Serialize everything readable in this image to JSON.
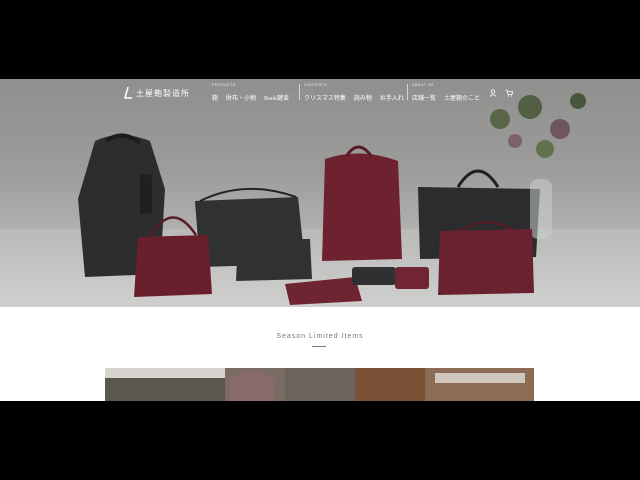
{
  "brand": {
    "name": "土屋鞄製造所"
  },
  "nav": {
    "groups": [
      {
        "label": "PRODUCTS",
        "items": [
          "鞄",
          "財布・小物",
          "Book鍵束"
        ]
      },
      {
        "label": "CONTENTS",
        "items": [
          "クリスマス特集",
          "読み物",
          "お手入れ"
        ]
      },
      {
        "label": "ABOUT US",
        "items": [
          "店舗一覧",
          "土屋鞄のこと"
        ]
      }
    ],
    "icons": [
      "user-icon",
      "cart-icon"
    ]
  },
  "section": {
    "title": "Season Limited Items"
  },
  "colors": {
    "burgundy": "#6e2230",
    "charcoal": "#2d2f31",
    "background": "#000000"
  }
}
